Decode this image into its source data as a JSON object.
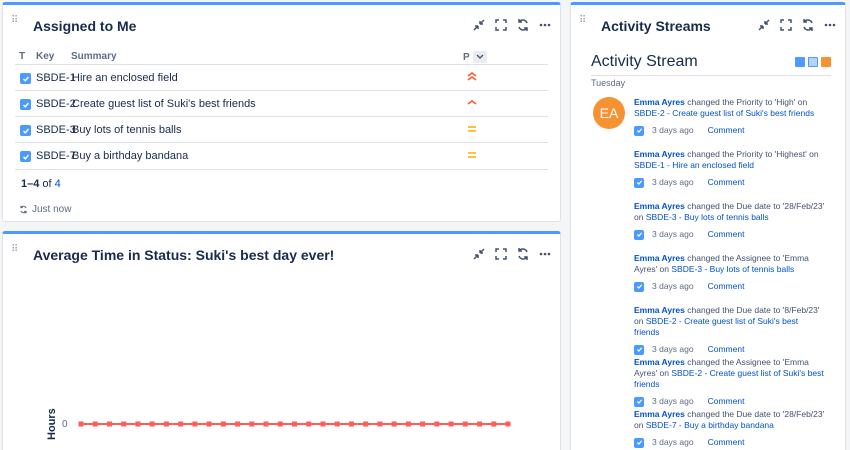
{
  "assigned": {
    "title": "Assigned to Me",
    "columns": {
      "t": "T",
      "key": "Key",
      "summary": "Summary",
      "p": "P"
    },
    "rows": [
      {
        "key": "SBDE-1",
        "summary": "Hire an enclosed field",
        "priority": "highest",
        "priority_color": "#ff5630"
      },
      {
        "key": "SBDE-2",
        "summary": "Create guest list of Suki's best friends",
        "priority": "high",
        "priority_color": "#ff5630"
      },
      {
        "key": "SBDE-3",
        "summary": "Buy lots of tennis balls",
        "priority": "medium",
        "priority_color": "#ffab00"
      },
      {
        "key": "SBDE-7",
        "summary": "Buy a birthday bandana",
        "priority": "medium",
        "priority_color": "#ffab00"
      }
    ],
    "pager": {
      "range": "1–4",
      "of": "of",
      "total": "4"
    },
    "refresh": "Just now"
  },
  "avgtime": {
    "title": "Average Time in Status: Suki's best day ever!",
    "chart_data": {
      "type": "line",
      "ylabel": "Hours",
      "yticks": [
        "0"
      ],
      "series": [
        {
          "color": "#ff5c5c",
          "values": [
            0,
            0,
            0,
            0,
            0,
            0,
            0,
            0,
            0,
            0,
            0,
            0,
            0,
            0,
            0,
            0,
            0,
            0,
            0,
            0,
            0,
            0,
            0,
            0,
            0,
            0,
            0,
            0,
            0,
            0,
            0
          ]
        }
      ]
    }
  },
  "activity": {
    "gadget_title": "Activity Streams",
    "title": "Activity Stream",
    "day": "Tuesday",
    "avatar": "EA",
    "entries": [
      {
        "user": "Emma Ayres",
        "text": "changed the Priority to 'High' on",
        "link": "SBDE-2 - Create guest list of Suki's best friends",
        "time": "3 days ago",
        "comment": "Comment"
      },
      {
        "user": "Emma Ayres",
        "text": "changed the Priority to 'Highest' on",
        "link": "SBDE-1 - Hire an enclosed field",
        "time": "3 days ago",
        "comment": "Comment"
      },
      {
        "user": "Emma Ayres",
        "text": "changed the Due date to '28/Feb/23' on",
        "link": "SBDE-3 - Buy lots of tennis balls",
        "time": "3 days ago",
        "comment": "Comment"
      },
      {
        "user": "Emma Ayres",
        "text": "changed the Assignee to 'Emma Ayres' on",
        "link": "SBDE-3 - Buy lots of tennis balls",
        "time": "3 days ago",
        "comment": "Comment"
      },
      {
        "user": "Emma Ayres",
        "text": "changed the Due date to '8/Feb/23' on",
        "link": "SBDE-2 - Create guest list of Suki's best friends",
        "time": "3 days ago",
        "comment": "Comment"
      },
      {
        "user": "Emma Ayres",
        "text": "changed the Assignee to 'Emma Ayres' on",
        "link": "SBDE-2 - Create guest list of Suki's best friends",
        "time": "3 days ago",
        "comment": "Comment"
      },
      {
        "user": "Emma Ayres",
        "text": "changed the Due date to '28/Feb/23' on",
        "link": "SBDE-7 - Buy a birthday bandana",
        "time": "3 days ago",
        "comment": "Comment"
      }
    ]
  }
}
